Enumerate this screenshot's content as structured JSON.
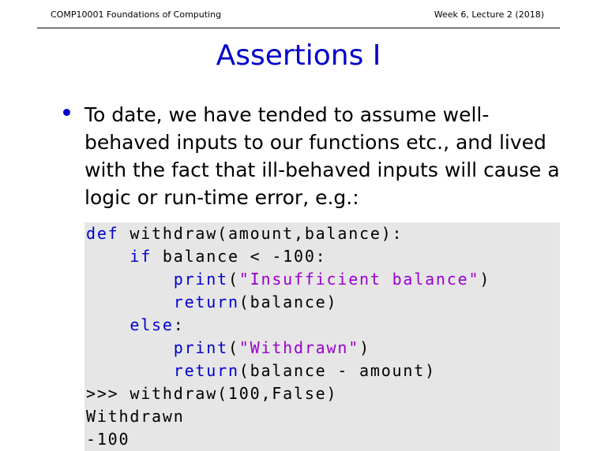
{
  "header": {
    "course": "COMP10001 Foundations of Computing",
    "lecture": "Week 6, Lecture 2 (2018)"
  },
  "slide": {
    "title": "Assertions I",
    "bullet": "To date, we have tended to assume well-behaved inputs to our functions etc., and lived with the fact that ill-behaved inputs will cause a logic or run-time error, e.g.:"
  },
  "code": {
    "l1_kw": "def",
    "l1_rest": " withdraw(amount,balance):",
    "l2_indent": "    ",
    "l2_kw": "if",
    "l2_rest": " balance < -100:",
    "l3_indent": "        ",
    "l3_kw": "print",
    "l3_open": "(",
    "l3_str": "\"Insufficient balance\"",
    "l3_close": ")",
    "l4_indent": "        ",
    "l4_kw": "return",
    "l4_rest": "(balance)",
    "l5_indent": "    ",
    "l5_kw": "else",
    "l5_rest": ":",
    "l6_indent": "        ",
    "l6_kw": "print",
    "l6_open": "(",
    "l6_str": "\"Withdrawn\"",
    "l6_close": ")",
    "l7_indent": "        ",
    "l7_kw": "return",
    "l7_rest": "(balance - amount)",
    "l8": ">>> withdraw(100,False)",
    "l9": "Withdrawn",
    "l10": "-100"
  },
  "colors": {
    "accent": "#0000cc",
    "string": "#9900cc",
    "code_bg": "#e6e6e6"
  }
}
